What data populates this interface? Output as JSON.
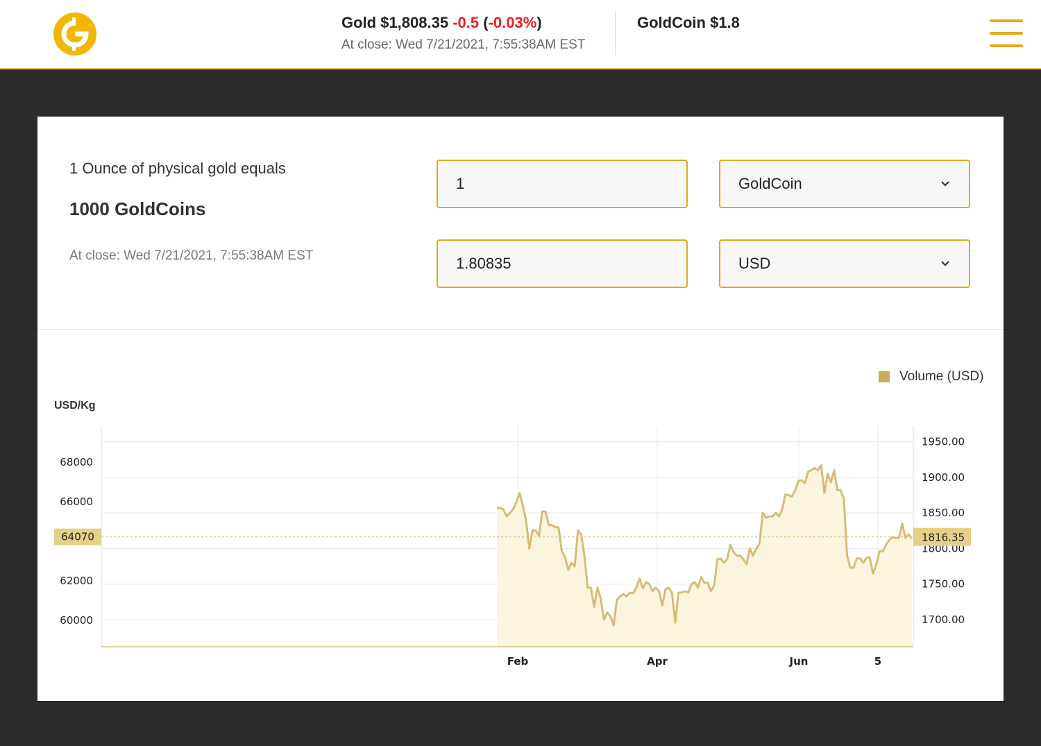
{
  "header": {
    "gold_label": "Gold $1,808.35",
    "gold_change": "-0.5",
    "gold_change_pct": "-0.03%",
    "gold_time": "At close: Wed 7/21/2021, 7:55:38AM EST",
    "coin_price": "GoldCoin $1.8",
    "brand_color": "#f2b705"
  },
  "converter": {
    "label": "1 Ounce of physical gold equals",
    "value": "1000 GoldCoins",
    "time": "At close: Wed 7/21/2021, 7:55:38AM EST",
    "amount_top": "1",
    "currency_top": "GoldCoin",
    "amount_bottom": "1.80835",
    "currency_bottom": "USD"
  },
  "chart_data": {
    "type": "area",
    "legend": "Volume (USD)",
    "left_axis_label": "USD/Kg",
    "left_ticks": [
      68000,
      66000,
      64000,
      62000,
      60000
    ],
    "right_ticks": [
      "1950.00",
      "1900.00",
      "1850.00",
      "1800.00",
      "1750.00",
      "1700.00"
    ],
    "x_ticks": [
      "Feb",
      "Apr",
      "Jun",
      "5"
    ],
    "left_marker": "64070",
    "right_marker": "1816.35",
    "marker_value": 1816.35,
    "ylim": [
      1662,
      1972
    ],
    "color": "#d6bc76",
    "fill": "#fdf4df",
    "series": [
      {
        "values": [
          1857,
          1857,
          1855,
          1845,
          1850,
          1855,
          1865,
          1878,
          1860,
          1840,
          1800,
          1826,
          1825,
          1818,
          1852,
          1852,
          1833,
          1833,
          1830,
          1830,
          1797,
          1788,
          1770,
          1780,
          1775,
          1826,
          1820,
          1790,
          1745,
          1745,
          1718,
          1745,
          1730,
          1700,
          1710,
          1705,
          1692,
          1728,
          1733,
          1736,
          1733,
          1738,
          1737,
          1745,
          1758,
          1744,
          1753,
          1750,
          1740,
          1745,
          1740,
          1720,
          1743,
          1745,
          1738,
          1696,
          1738,
          1738,
          1740,
          1738,
          1750,
          1753,
          1745,
          1760,
          1752,
          1752,
          1740,
          1748,
          1785,
          1786,
          1780,
          1785,
          1805,
          1795,
          1790,
          1790,
          1785,
          1778,
          1800,
          1790,
          1800,
          1807,
          1850,
          1843,
          1845,
          1845,
          1850,
          1845,
          1855,
          1876,
          1875,
          1873,
          1882,
          1895,
          1896,
          1892,
          1908,
          1910,
          1913,
          1910,
          1917,
          1878,
          1905,
          1893,
          1910,
          1882,
          1882,
          1870,
          1790,
          1773,
          1773,
          1786,
          1786,
          1780,
          1787,
          1787,
          1765,
          1777,
          1796,
          1796,
          1805,
          1812,
          1816,
          1815,
          1815,
          1835,
          1815,
          1820,
          1814
        ]
      }
    ]
  }
}
